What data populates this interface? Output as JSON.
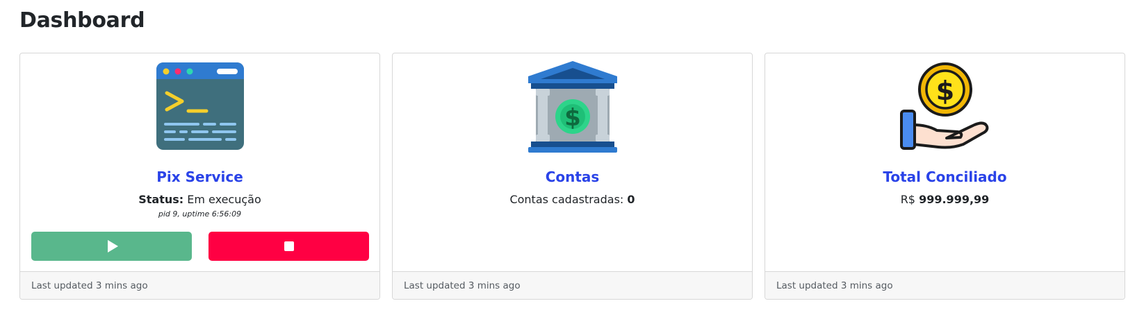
{
  "page": {
    "title": "Dashboard"
  },
  "colors": {
    "title_link": "#2a43e8",
    "start_button": "#59b78c",
    "stop_button": "#ff0043",
    "footer_bg": "#f7f7f7"
  },
  "cards": [
    {
      "icon": "terminal-window-icon",
      "title": "Pix Service",
      "status_label": "Status:",
      "status_value": "Em execução",
      "details": "pid 9, uptime 6:56:09",
      "start_button_icon": "play-icon",
      "stop_button_icon": "stop-icon",
      "footer": "Last updated 3 mins ago"
    },
    {
      "icon": "bank-dollar-icon",
      "title": "Contas",
      "stat_label": "Contas cadastradas:",
      "stat_value": "0",
      "footer": "Last updated 3 mins ago"
    },
    {
      "icon": "hand-coin-icon",
      "title": "Total Conciliado",
      "currency": "R$",
      "amount": "999.999,99",
      "footer": "Last updated 3 mins ago"
    }
  ]
}
